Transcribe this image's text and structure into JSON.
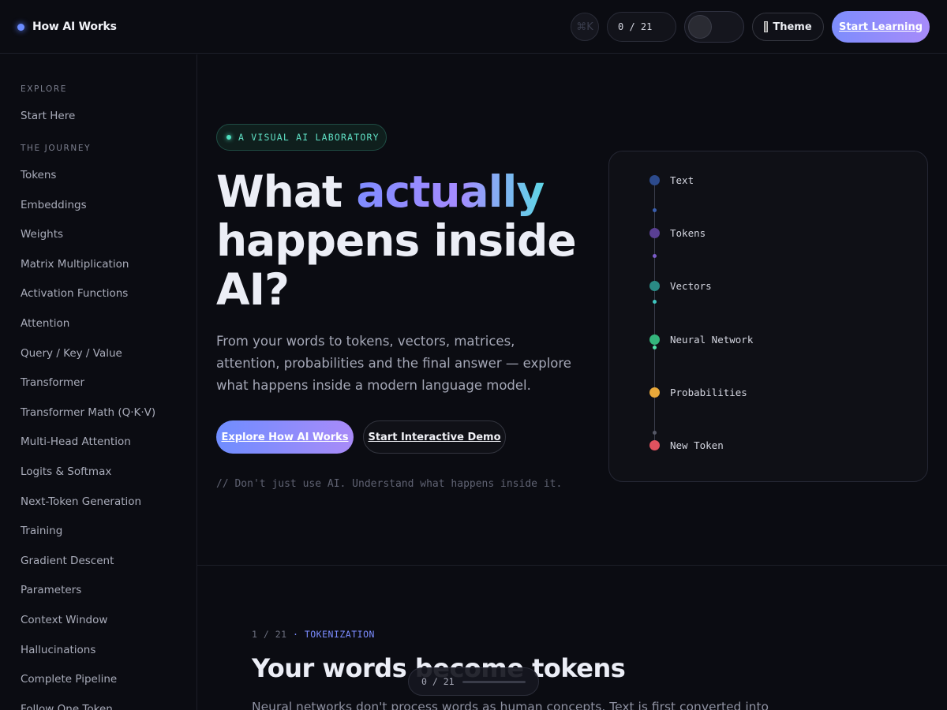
{
  "header": {
    "brand": "How AI Works",
    "cmd_shortcut": "⌘K",
    "progress_text": "0 / 21",
    "theme_label": "Theme",
    "start_label": "Start Learning"
  },
  "sidebar": {
    "explore_heading": "EXPLORE",
    "start_here": "Start Here",
    "journey_heading": "THE JOURNEY",
    "items": [
      "Tokens",
      "Embeddings",
      "Weights",
      "Matrix Multiplication",
      "Activation Functions",
      "Attention",
      "Query / Key / Value",
      "Transformer",
      "Transformer Math (Q·K·V)",
      "Multi-Head Attention",
      "Logits & Softmax",
      "Next-Token Generation",
      "Training",
      "Gradient Descent",
      "Parameters",
      "Context Window",
      "Hallucinations",
      "Complete Pipeline",
      "Follow One Token"
    ]
  },
  "hero": {
    "badge": "A VISUAL AI LABORATORY",
    "title_part1": "What ",
    "title_highlight": "actually",
    "title_part2": " happens inside AI?",
    "subtitle": "From your words to tokens, vectors, matrices, attention, probabilities and the final answer — explore what happens inside a modern language model.",
    "primary_cta": "Explore How AI Works",
    "secondary_cta": "Start Interactive Demo",
    "tagline": "// Don't just use AI. Understand what happens inside it."
  },
  "pipeline": {
    "stages": [
      {
        "label": "Text",
        "color": "#2c4a8c"
      },
      {
        "label": "Tokens",
        "color": "#5a3f93"
      },
      {
        "label": "Vectors",
        "color": "#2a8a85"
      },
      {
        "label": "Neural Network",
        "color": "#34b57c"
      },
      {
        "label": "Probabilities",
        "color": "#e8a83a"
      },
      {
        "label": "New Token",
        "color": "#e0525f"
      }
    ],
    "pulse_colors": [
      "#3a5fb0",
      "#7a5cc8",
      "#3fc6c0",
      "#4de0a6",
      "#555866"
    ]
  },
  "section": {
    "step": "1 / 21",
    "separator": " · ",
    "topic": "TOKENIZATION",
    "title": "Your words become tokens",
    "body": "Neural networks don't process words as human concepts. Text is first converted into"
  },
  "floating_progress": {
    "text": "0 / 21",
    "fraction": 0
  }
}
